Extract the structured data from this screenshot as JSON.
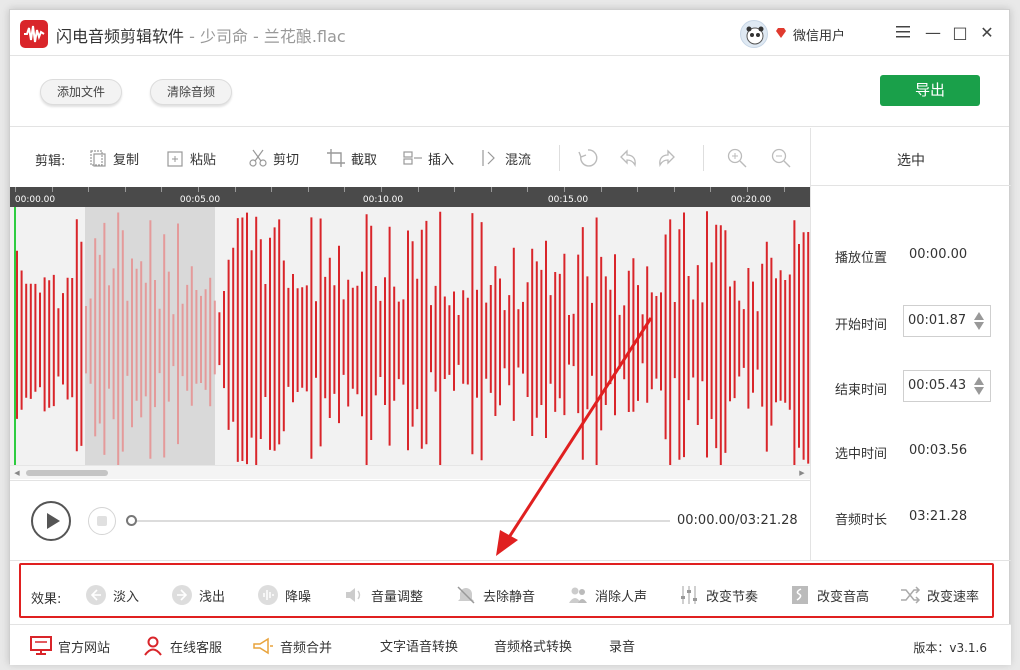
{
  "title_bar": {
    "app_name": "闪电音频剪辑软件",
    "separator": " - ",
    "file_name": "少司命 - 兰花酿.flac",
    "user_name": "微信用户",
    "minimize": "—",
    "maximize": "□",
    "close": "✕"
  },
  "toolbar": {
    "add_file": "添加文件",
    "clear_audio": "清除音频",
    "export": "导出"
  },
  "edit_bar": {
    "label": "剪辑:",
    "tools": [
      "复制",
      "粘贴",
      "剪切",
      "截取",
      "插入",
      "混流"
    ]
  },
  "side_panel": {
    "header": "选中",
    "play_position_label": "播放位置",
    "play_position_value": "00:00.00",
    "start_time_label": "开始时间",
    "start_time_value": "00:01.87",
    "end_time_label": "结束时间",
    "end_time_value": "00:05.43",
    "selected_time_label": "选中时间",
    "selected_time_value": "00:03.56",
    "duration_label": "音频时长",
    "duration_value": "03:21.28"
  },
  "timeline": {
    "ticks": [
      "00:00.00",
      "00:05.00",
      "00:10.00",
      "00:15.00",
      "00:20.00"
    ]
  },
  "player": {
    "time_readout": "00:00.00/03:21.28",
    "progress": 0
  },
  "effects": {
    "label": "效果:",
    "items": [
      "淡入",
      "浅出",
      "降噪",
      "音量调整",
      "去除静音",
      "消除人声",
      "改变节奏",
      "改变音高",
      "改变速率"
    ]
  },
  "footer": {
    "official_site": "官方网站",
    "online_service": "在线客服",
    "audio_merge": "音频合并",
    "tts": "文字语音转换",
    "format_convert": "音频格式转换",
    "record": "录音",
    "version": "版本：v3.1.6"
  },
  "colors": {
    "waveform": "#d9252a",
    "selection_waveform": "#e49a9a",
    "export_button": "#1aa04a",
    "highlight_box": "#e02020",
    "cursor_line": "#2ecc40"
  }
}
